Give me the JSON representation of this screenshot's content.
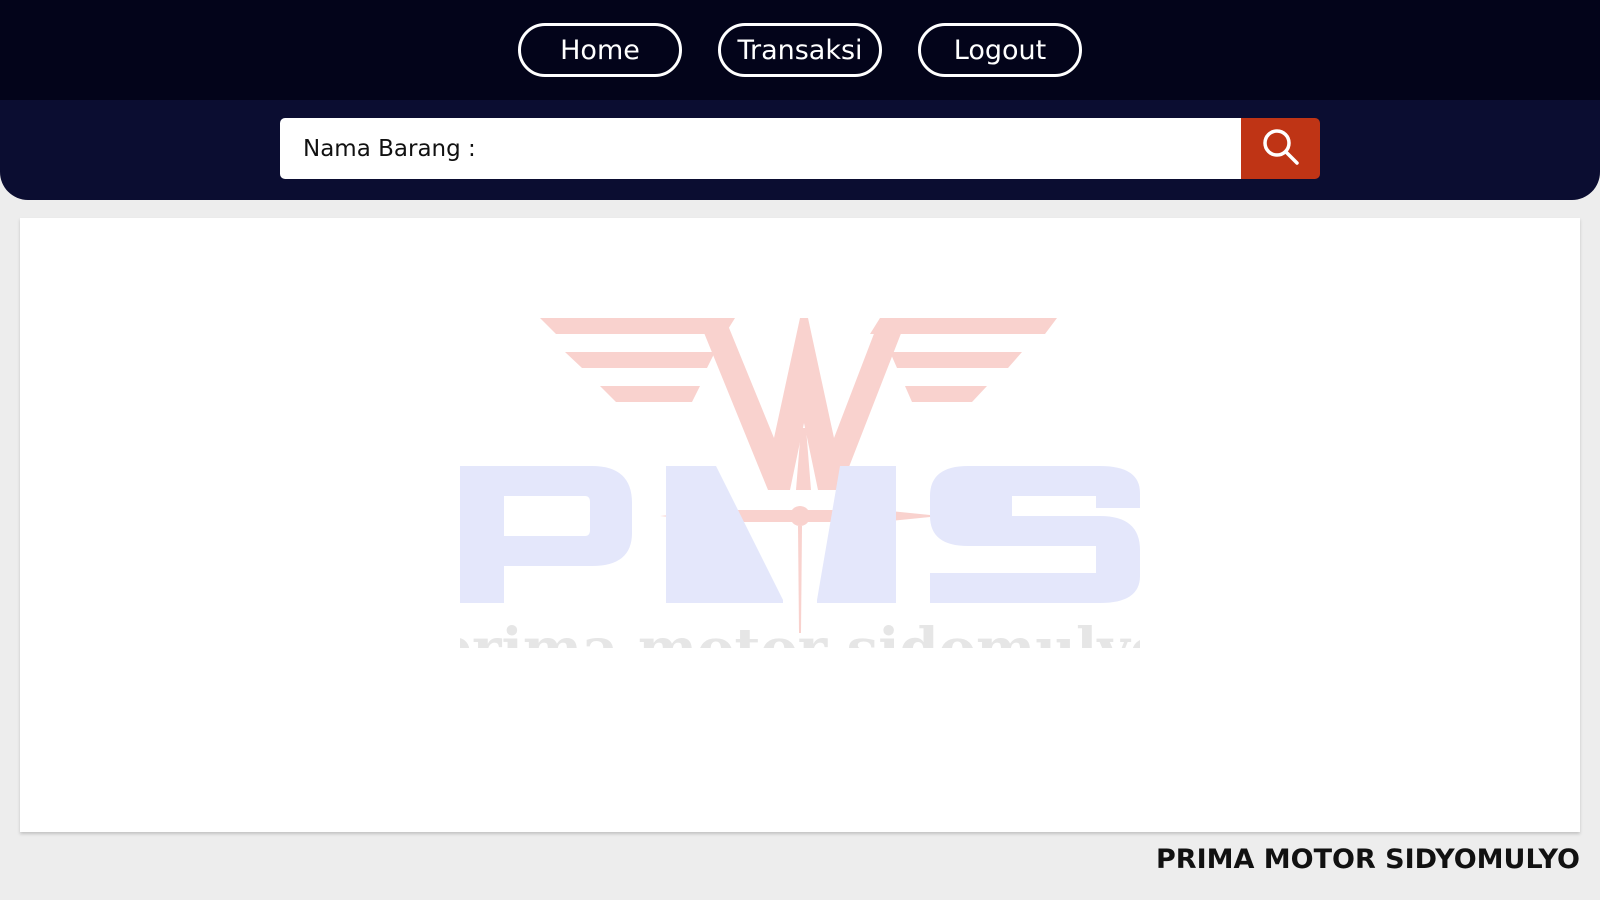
{
  "nav": {
    "home_label": "Home",
    "transaksi_label": "Transaksi",
    "logout_label": "Logout"
  },
  "search": {
    "label": "Nama Barang :",
    "value": "",
    "button_icon": "search-icon"
  },
  "logo": {
    "wordmark": "PMS",
    "tagline": "prima motor sidomulyo"
  },
  "footer": {
    "brand": "PRIMA MOTOR SIDYOMULYO"
  },
  "colors": {
    "topbar": "#03041a",
    "searchband": "#0b0d31",
    "search_button": "#bf3415",
    "logo_red": "#f9d2ce",
    "logo_blue": "#e4e7fb",
    "logo_gray": "#e6e6e6"
  }
}
